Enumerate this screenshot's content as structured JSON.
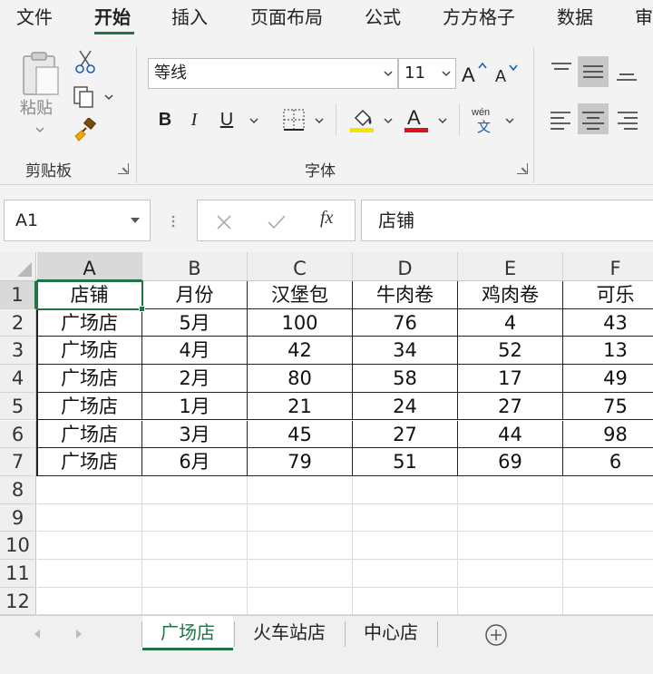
{
  "menu": {
    "tabs": [
      "文件",
      "开始",
      "插入",
      "页面布局",
      "公式",
      "方方格子",
      "数据",
      "审"
    ],
    "active_index": 1
  },
  "ribbon": {
    "clipboard": {
      "paste_label": "粘贴",
      "group_label": "剪贴板"
    },
    "font": {
      "font_name": "等线",
      "font_size": "11",
      "bold": "B",
      "italic": "I",
      "underline": "U",
      "group_label": "字体",
      "highlight_color": "#f5e300",
      "font_color": "#e0101a",
      "phonetic_top": "wén",
      "phonetic_bottom": "文"
    }
  },
  "formula_bar": {
    "name_box": "A1",
    "fx_label": "fx",
    "content": "店铺"
  },
  "grid": {
    "columns": [
      "A",
      "B",
      "C",
      "D",
      "E",
      "F"
    ],
    "rows": [
      "1",
      "2",
      "3",
      "4",
      "5",
      "6",
      "7",
      "8",
      "9",
      "10",
      "11",
      "12"
    ],
    "selected_cell": "A1",
    "data": [
      [
        "店铺",
        "月份",
        "汉堡包",
        "牛肉卷",
        "鸡肉卷",
        "可乐"
      ],
      [
        "广场店",
        "5月",
        "100",
        "76",
        "4",
        "43"
      ],
      [
        "广场店",
        "4月",
        "42",
        "34",
        "52",
        "13"
      ],
      [
        "广场店",
        "2月",
        "80",
        "58",
        "17",
        "49"
      ],
      [
        "广场店",
        "1月",
        "21",
        "24",
        "27",
        "75"
      ],
      [
        "广场店",
        "3月",
        "45",
        "27",
        "44",
        "98"
      ],
      [
        "广场店",
        "6月",
        "79",
        "51",
        "69",
        "6"
      ]
    ]
  },
  "sheets": {
    "tabs": [
      "广场店",
      "火车站店",
      "中心店"
    ],
    "active_index": 0
  },
  "colors": {
    "accent": "#217346"
  }
}
